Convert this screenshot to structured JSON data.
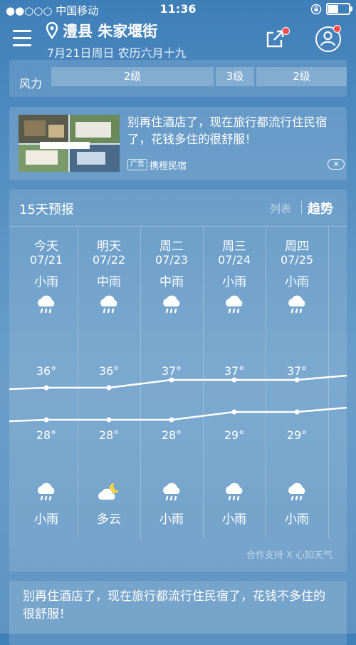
{
  "status_bar": {
    "carrier": "●●○○○ 中国移动",
    "time": "11:36"
  },
  "header": {
    "location": "澧县 朱家堰街",
    "date_line": "7月21日周日 农历六月十九"
  },
  "wind": {
    "label": "风力",
    "levels": [
      "2级",
      "3级",
      "2级"
    ]
  },
  "ad1": {
    "text": "别再住酒店了，现在旅行都流行住民宿了，花钱多住的很舒服！",
    "badge": "广告",
    "source": "携程民宿",
    "close": "✕"
  },
  "forecast": {
    "title": "15天预报",
    "tab_list": "列表",
    "tab_trend": "趋势",
    "credit": "合作支持 X 心知天气",
    "days": [
      {
        "name": "今天",
        "date": "07/21",
        "day_cond": "小雨",
        "day_icon": "rain-cloud-icon",
        "high": "36°",
        "low": "28°",
        "night_icon": "rain-cloud-icon",
        "night_cond": "小雨"
      },
      {
        "name": "明天",
        "date": "07/22",
        "day_cond": "中雨",
        "day_icon": "rain-cloud-icon",
        "high": "36°",
        "low": "28°",
        "night_icon": "moon-cloud-icon",
        "night_cond": "多云"
      },
      {
        "name": "周二",
        "date": "07/23",
        "day_cond": "中雨",
        "day_icon": "rain-cloud-icon",
        "high": "37°",
        "low": "28°",
        "night_icon": "rain-cloud-icon",
        "night_cond": "小雨"
      },
      {
        "name": "周三",
        "date": "07/24",
        "day_cond": "小雨",
        "day_icon": "rain-cloud-icon",
        "high": "37°",
        "low": "29°",
        "night_icon": "rain-cloud-icon",
        "night_cond": "小雨"
      },
      {
        "name": "周四",
        "date": "07/25",
        "day_cond": "小雨",
        "day_icon": "rain-cloud-icon",
        "high": "37°",
        "low": "29°",
        "night_icon": "rain-cloud-icon",
        "night_cond": "小雨"
      }
    ]
  },
  "ad2": {
    "text": "别再住酒店了，现在旅行都流行住民宿了，花钱不多住的很舒服！"
  }
}
